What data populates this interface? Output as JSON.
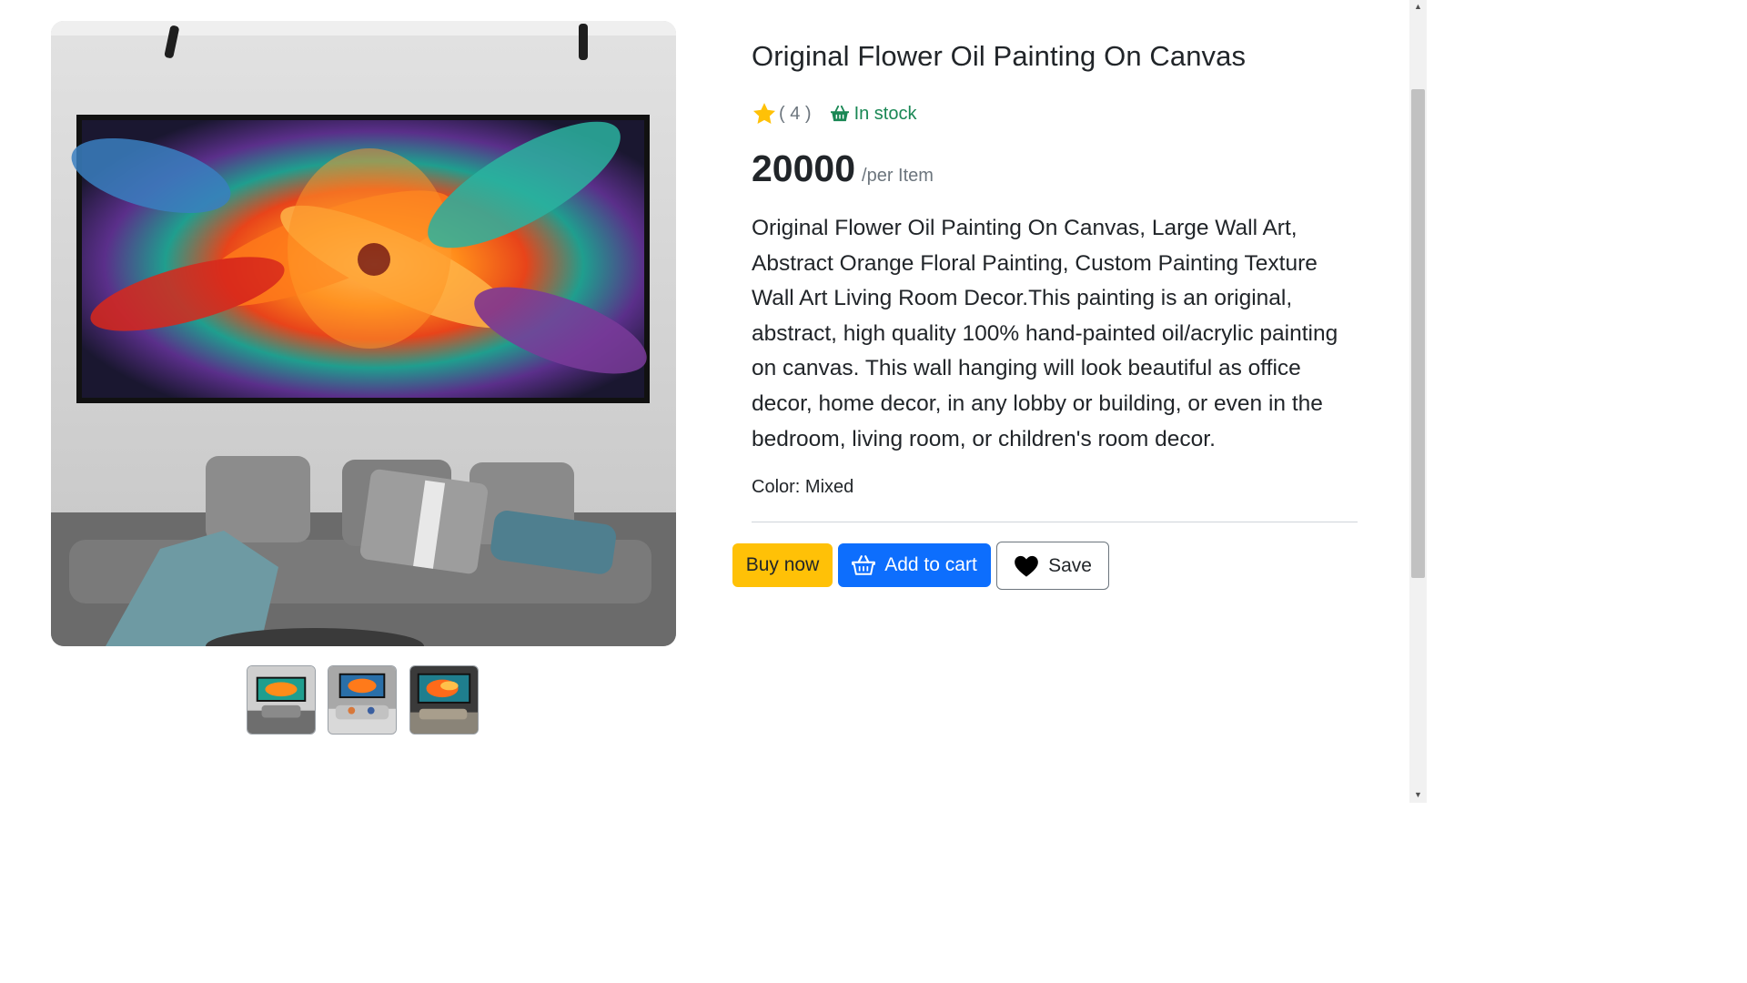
{
  "product": {
    "title": "Original Flower Oil Painting On Canvas",
    "rating": "( 4 )",
    "stock_status": "In stock",
    "price": "20000",
    "price_unit": "/per Item",
    "description": "Original Flower Oil Painting On Canvas, Large Wall Art, Abstract Orange Floral Painting, Custom Painting Texture Wall Art Living Room Decor.This painting is an original, abstract, high quality 100% hand-painted oil/acrylic painting on canvas. This wall hanging will look beautiful as office decor, home decor, in any lobby or building, or even in the bedroom, living room, or children's room decor.",
    "color_line": "Color: Mixed"
  },
  "gallery": {
    "thumbnails": 3
  },
  "actions": {
    "buy_now": "Buy now",
    "add_to_cart": "Add to cart",
    "save": "Save"
  },
  "icons": {
    "rating": "star-icon",
    "stock": "basket-icon",
    "cart": "basket-icon",
    "save": "heart-icon"
  },
  "colors": {
    "star": "#ffc107",
    "stock": "#198754",
    "buy_now": "#ffc107",
    "add_to_cart": "#0d6efd"
  }
}
